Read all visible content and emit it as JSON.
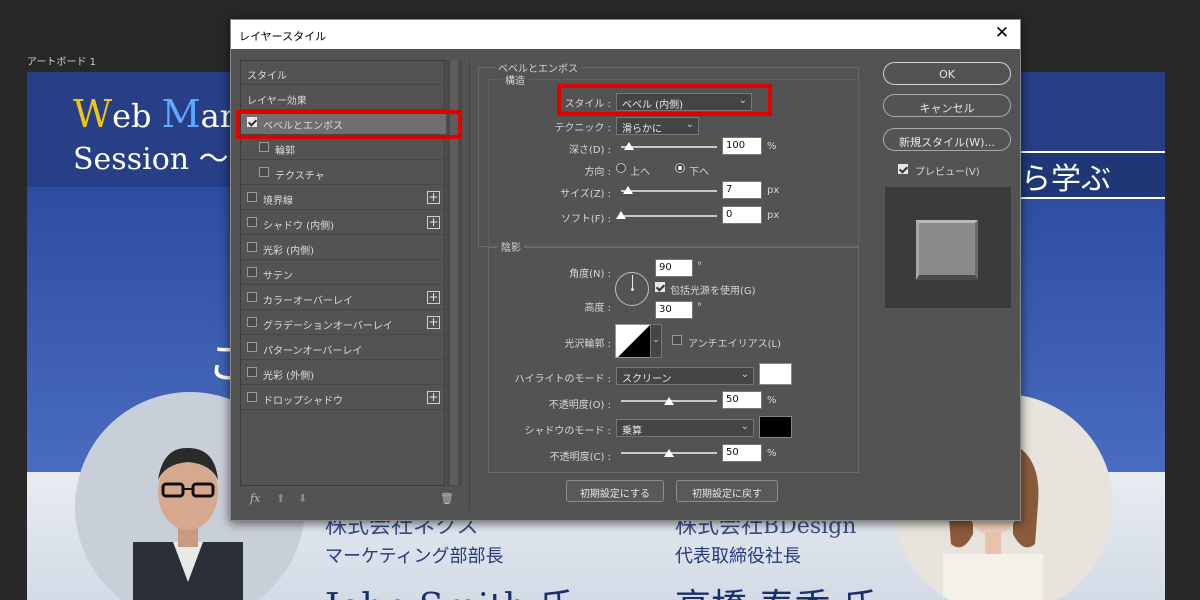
{
  "canvas": {
    "artboard_label": "アートボード 1",
    "title_line1_w": "W",
    "title_line1_rest": "eb ",
    "title_line1_m": "M",
    "title_line1_tail": "ar",
    "title_line2": "Session ～",
    "right_heading": "ら学ぶ",
    "mid_glyph": "こ",
    "company_left": "株式会社ネクス",
    "company_right": "株式会社BDesign",
    "role_left": "マーケティング部部長",
    "role_right": "代表取締役社長",
    "name_left": "John Smith 氏",
    "name_right": "高橋 春香 氏"
  },
  "dialog": {
    "title": "レイヤースタイル",
    "close_glyph": "✕",
    "style_list": [
      {
        "label": "スタイル",
        "checkbox": false,
        "checked": false,
        "plus": false,
        "indent": 0
      },
      {
        "label": "レイヤー効果",
        "checkbox": false,
        "checked": false,
        "plus": false,
        "indent": 0
      },
      {
        "label": "ベベルとエンボス",
        "checkbox": true,
        "checked": true,
        "plus": false,
        "indent": 0,
        "selected": true
      },
      {
        "label": "輪郭",
        "checkbox": true,
        "checked": false,
        "plus": false,
        "indent": 1
      },
      {
        "label": "テクスチャ",
        "checkbox": true,
        "checked": false,
        "plus": false,
        "indent": 1
      },
      {
        "label": "境界線",
        "checkbox": true,
        "checked": false,
        "plus": true,
        "indent": 0
      },
      {
        "label": "シャドウ (内側)",
        "checkbox": true,
        "checked": false,
        "plus": true,
        "indent": 0
      },
      {
        "label": "光彩 (内側)",
        "checkbox": true,
        "checked": false,
        "plus": false,
        "indent": 0
      },
      {
        "label": "サテン",
        "checkbox": true,
        "checked": false,
        "plus": false,
        "indent": 0
      },
      {
        "label": "カラーオーバーレイ",
        "checkbox": true,
        "checked": false,
        "plus": true,
        "indent": 0
      },
      {
        "label": "グラデーションオーバーレイ",
        "checkbox": true,
        "checked": false,
        "plus": true,
        "indent": 0
      },
      {
        "label": "パターンオーバーレイ",
        "checkbox": true,
        "checked": false,
        "plus": false,
        "indent": 0
      },
      {
        "label": "光彩 (外側)",
        "checkbox": true,
        "checked": false,
        "plus": false,
        "indent": 0
      },
      {
        "label": "ドロップシャドウ",
        "checkbox": true,
        "checked": false,
        "plus": true,
        "indent": 0
      }
    ],
    "footer": {
      "fx": "fx",
      "up": "⬆",
      "down": "⬇",
      "trash": "🗑"
    },
    "bevel": {
      "section_title": "ベベルとエンボス",
      "structure_title": "構造",
      "style_label": "スタイル :",
      "style_value": "ベベル (内側)",
      "technique_label": "テクニック :",
      "technique_value": "滑らかに",
      "depth_label": "深さ(D) :",
      "depth_value": "100",
      "depth_unit": "%",
      "depth_level": 0.08,
      "direction_label": "方向 :",
      "dir_up": "上へ",
      "dir_down": "下へ",
      "direction_selected": "down",
      "size_label": "サイズ(Z) :",
      "size_value": "7",
      "size_unit": "px",
      "size_level": 0.07,
      "soften_label": "ソフト(F) :",
      "soften_value": "0",
      "soften_unit": "px",
      "soften_level": 0.0
    },
    "shading": {
      "title": "陰影",
      "angle_label": "角度(N) :",
      "angle_value": "90",
      "angle_unit": "°",
      "global_light_label": "包括光源を使用(G)",
      "global_light_checked": true,
      "altitude_label": "高度 :",
      "altitude_value": "30",
      "altitude_unit": "°",
      "gloss_label": "光沢輪郭 :",
      "antialias_label": "アンチエイリアス(L)",
      "antialias_checked": false,
      "highlight_mode_label": "ハイライトのモード :",
      "highlight_mode_value": "スクリーン",
      "highlight_color": "#ffffff",
      "highlight_opacity_label": "不透明度(O) :",
      "highlight_opacity_value": "50",
      "highlight_opacity_unit": "%",
      "highlight_opacity_level": 0.5,
      "shadow_mode_label": "シャドウのモード :",
      "shadow_mode_value": "乗算",
      "shadow_color": "#000000",
      "shadow_opacity_label": "不透明度(C) :",
      "shadow_opacity_value": "50",
      "shadow_opacity_unit": "%",
      "shadow_opacity_level": 0.5
    },
    "buttons": {
      "make_default": "初期設定にする",
      "reset_default": "初期設定に戻す",
      "ok": "OK",
      "cancel": "キャンセル",
      "new_style": "新規スタイル(W)...",
      "preview_label": "プレビュー(V)",
      "preview_checked": true
    },
    "accent_color": "#e00000"
  }
}
